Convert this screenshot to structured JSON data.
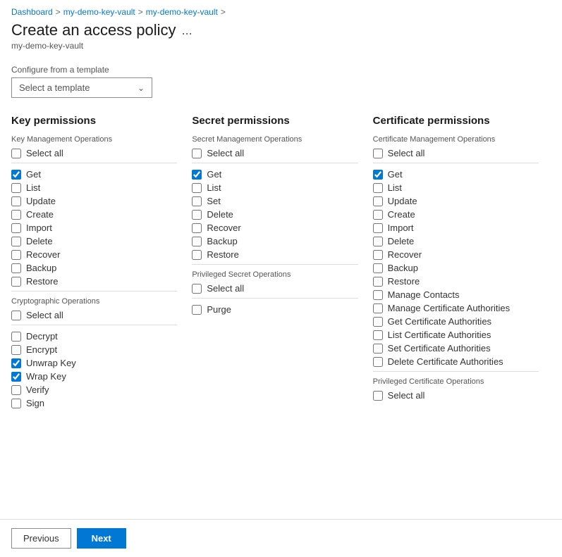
{
  "breadcrumb": {
    "items": [
      "Dashboard",
      "my-demo-key-vault",
      "my-demo-key-vault"
    ]
  },
  "header": {
    "title": "Create an access policy",
    "subtitle": "my-demo-key-vault",
    "ellipsis": "..."
  },
  "template": {
    "label": "Configure from a template",
    "placeholder": "Select a template"
  },
  "columns": {
    "key": {
      "title": "Key permissions",
      "sections": [
        {
          "label": "Key Management Operations",
          "items": [
            {
              "id": "key-select-all",
              "label": "Select all",
              "checked": false
            },
            {
              "id": "key-get",
              "label": "Get",
              "checked": true
            },
            {
              "id": "key-list",
              "label": "List",
              "checked": false
            },
            {
              "id": "key-update",
              "label": "Update",
              "checked": false
            },
            {
              "id": "key-create",
              "label": "Create",
              "checked": false
            },
            {
              "id": "key-import",
              "label": "Import",
              "checked": false
            },
            {
              "id": "key-delete",
              "label": "Delete",
              "checked": false
            },
            {
              "id": "key-recover",
              "label": "Recover",
              "checked": false
            },
            {
              "id": "key-backup",
              "label": "Backup",
              "checked": false
            },
            {
              "id": "key-restore",
              "label": "Restore",
              "checked": false
            }
          ]
        },
        {
          "label": "Cryptographic Operations",
          "items": [
            {
              "id": "crypto-select-all",
              "label": "Select all",
              "checked": false
            },
            {
              "id": "crypto-decrypt",
              "label": "Decrypt",
              "checked": false
            },
            {
              "id": "crypto-encrypt",
              "label": "Encrypt",
              "checked": false
            },
            {
              "id": "crypto-unwrap",
              "label": "Unwrap Key",
              "checked": true
            },
            {
              "id": "crypto-wrap",
              "label": "Wrap Key",
              "checked": true
            },
            {
              "id": "crypto-verify",
              "label": "Verify",
              "checked": false
            },
            {
              "id": "crypto-sign",
              "label": "Sign",
              "checked": false
            }
          ]
        }
      ]
    },
    "secret": {
      "title": "Secret permissions",
      "sections": [
        {
          "label": "Secret Management Operations",
          "items": [
            {
              "id": "sec-select-all",
              "label": "Select all",
              "checked": false
            },
            {
              "id": "sec-get",
              "label": "Get",
              "checked": true
            },
            {
              "id": "sec-list",
              "label": "List",
              "checked": false
            },
            {
              "id": "sec-set",
              "label": "Set",
              "checked": false
            },
            {
              "id": "sec-delete",
              "label": "Delete",
              "checked": false
            },
            {
              "id": "sec-recover",
              "label": "Recover",
              "checked": false
            },
            {
              "id": "sec-backup",
              "label": "Backup",
              "checked": false
            },
            {
              "id": "sec-restore",
              "label": "Restore",
              "checked": false
            }
          ]
        },
        {
          "label": "Privileged Secret Operations",
          "items": [
            {
              "id": "psec-select-all",
              "label": "Select all",
              "checked": false
            },
            {
              "id": "psec-purge",
              "label": "Purge",
              "checked": false
            }
          ]
        }
      ]
    },
    "certificate": {
      "title": "Certificate permissions",
      "sections": [
        {
          "label": "Certificate Management Operations",
          "items": [
            {
              "id": "cert-select-all",
              "label": "Select all",
              "checked": false
            },
            {
              "id": "cert-get",
              "label": "Get",
              "checked": true
            },
            {
              "id": "cert-list",
              "label": "List",
              "checked": false
            },
            {
              "id": "cert-update",
              "label": "Update",
              "checked": false
            },
            {
              "id": "cert-create",
              "label": "Create",
              "checked": false
            },
            {
              "id": "cert-import",
              "label": "Import",
              "checked": false
            },
            {
              "id": "cert-delete",
              "label": "Delete",
              "checked": false
            },
            {
              "id": "cert-recover",
              "label": "Recover",
              "checked": false
            },
            {
              "id": "cert-backup",
              "label": "Backup",
              "checked": false
            },
            {
              "id": "cert-restore",
              "label": "Restore",
              "checked": false
            },
            {
              "id": "cert-manage-contacts",
              "label": "Manage Contacts",
              "checked": false
            },
            {
              "id": "cert-manage-ca",
              "label": "Manage Certificate Authorities",
              "checked": false
            },
            {
              "id": "cert-get-ca",
              "label": "Get Certificate Authorities",
              "checked": false
            },
            {
              "id": "cert-list-ca",
              "label": "List Certificate Authorities",
              "checked": false
            },
            {
              "id": "cert-set-ca",
              "label": "Set Certificate Authorities",
              "checked": false
            },
            {
              "id": "cert-delete-ca",
              "label": "Delete Certificate Authorities",
              "checked": false
            }
          ]
        },
        {
          "label": "Privileged Certificate Operations",
          "items": [
            {
              "id": "pcert-select-all",
              "label": "Select all",
              "checked": false
            }
          ]
        }
      ]
    }
  },
  "footer": {
    "previous_label": "Previous",
    "next_label": "Next"
  }
}
